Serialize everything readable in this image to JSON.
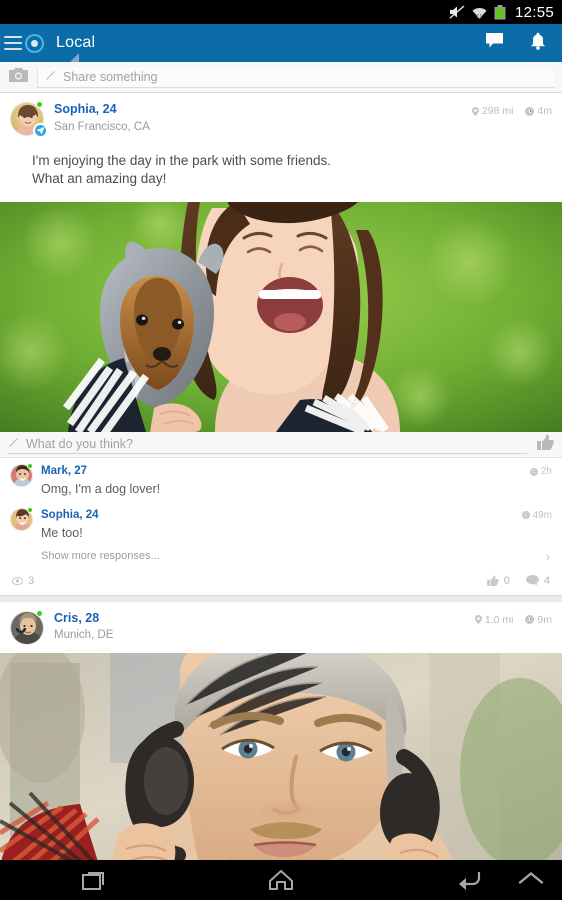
{
  "status_bar": {
    "time": "12:55",
    "icons": [
      "mute-icon",
      "wifi-icon",
      "battery-icon"
    ]
  },
  "app_bar": {
    "menu_icon": "hamburger-menu-icon",
    "logo_icon": "app-logo-icon",
    "title": "Local",
    "actions": [
      {
        "name": "messages-icon",
        "label": "Messages"
      },
      {
        "name": "notifications-icon",
        "label": "Notifications"
      }
    ]
  },
  "share_bar": {
    "camera_icon": "camera-icon",
    "pencil_icon": "pencil-icon",
    "placeholder": "Share something"
  },
  "posts": [
    {
      "author": "Sophia, 24",
      "location": "San Francisco, CA",
      "distance": "298 mi",
      "time": "4m",
      "text": "I'm enjoying the day in the park with some friends.\nWhat an amazing day!",
      "composer_placeholder": "What do you think?",
      "comments": [
        {
          "author": "Mark, 27",
          "text": "Omg, I'm a dog lover!",
          "time": "2h"
        },
        {
          "author": "Sophia, 24",
          "text": "Me too!",
          "time": "49m"
        }
      ],
      "show_more_label": "Show more responses...",
      "views": "3",
      "likes": "0",
      "replies": "4"
    },
    {
      "author": "Cris, 28",
      "location": "Munich, DE",
      "distance": "1.0 mi",
      "time": "9m"
    }
  ],
  "nav_bar": {
    "buttons": [
      "recents-icon",
      "home-icon",
      "back-icon",
      "chevron-up-icon"
    ]
  },
  "colors": {
    "accent": "#0b6ca8",
    "link": "#1a62b8",
    "online": "#35d118",
    "badge": "#29a8e0"
  }
}
